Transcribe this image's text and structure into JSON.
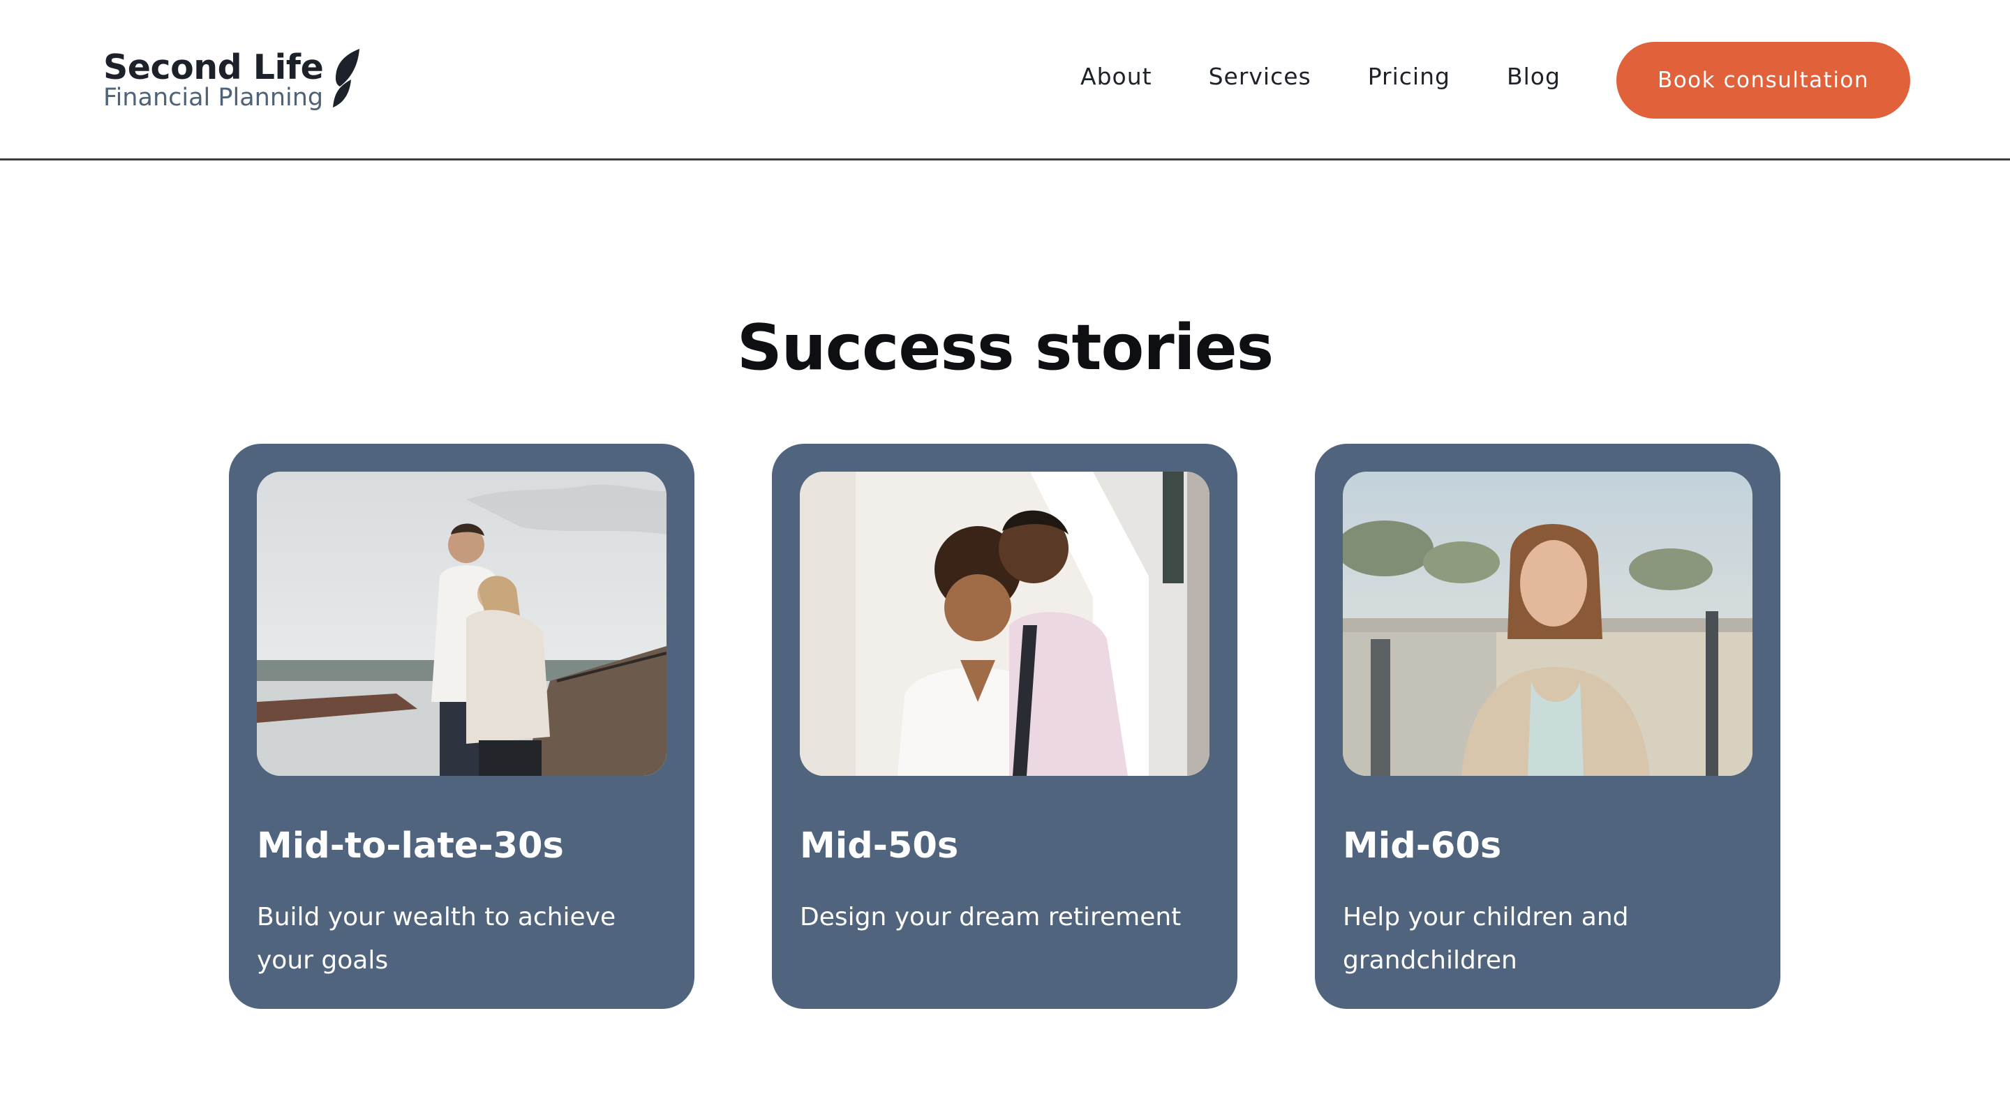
{
  "colors": {
    "accent": "#e0613a",
    "card_bg": "#50647d",
    "text_dark": "#1d2129",
    "logo_sub": "#4f6378"
  },
  "header": {
    "logo": {
      "title": "Second Life",
      "subtitle": "Financial Planning",
      "mark_icon": "leaf-icon"
    },
    "nav": [
      {
        "label": "About"
      },
      {
        "label": "Services"
      },
      {
        "label": "Pricing"
      },
      {
        "label": "Blog"
      }
    ],
    "cta_label": "Book consultation"
  },
  "section": {
    "title": "Success stories",
    "cards": [
      {
        "title": "Mid-to-late-30s",
        "description": "Build your wealth to achieve your goals",
        "photo": "couple-embracing-outdoors-photo"
      },
      {
        "title": "Mid-50s",
        "description": "Design your dream retirement",
        "photo": "smiling-couple-photo"
      },
      {
        "title": "Mid-60s",
        "description": "Help your children and grandchildren",
        "photo": "older-woman-street-photo"
      }
    ]
  }
}
